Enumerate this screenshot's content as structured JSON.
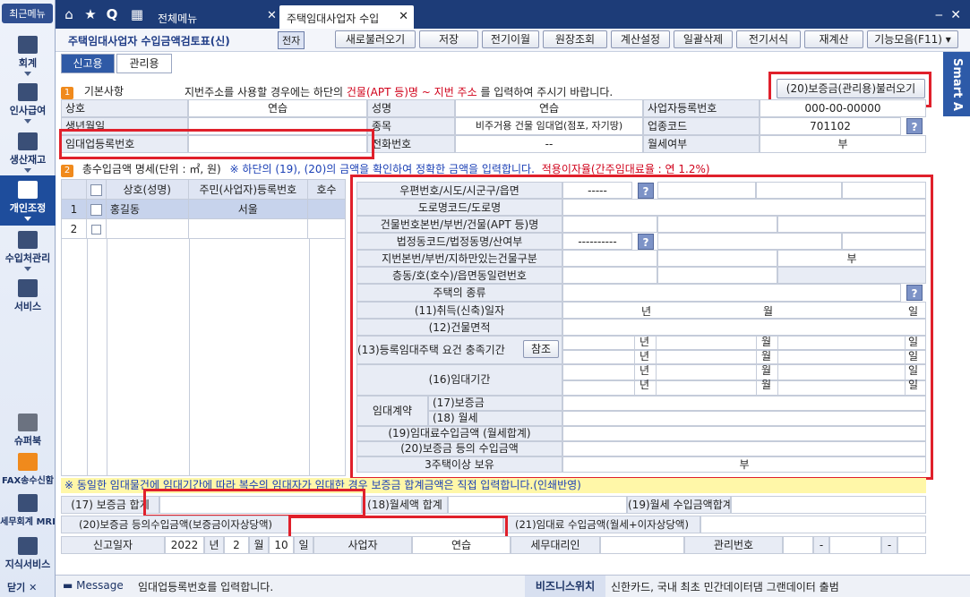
{
  "sidebar": {
    "top_label": "최근메뉴",
    "items": [
      {
        "label": "회계"
      },
      {
        "label": "인사급여"
      },
      {
        "label": "생산재고"
      },
      {
        "label": "개인조정"
      },
      {
        "label": "수입처관리"
      },
      {
        "label": "서비스"
      },
      {
        "label": "슈퍼북"
      },
      {
        "label": "FAX송수신함"
      },
      {
        "label": "세무회계 MRI"
      },
      {
        "label": "지식서비스"
      }
    ],
    "close_label": "닫기"
  },
  "tabs": [
    {
      "label": "전체메뉴"
    },
    {
      "label": "주택임대사업자 수입"
    }
  ],
  "toolbar": {
    "title": "주택임대사업자 수입금액검토표(신)",
    "badge": "전자",
    "buttons": [
      "새로불러오기",
      "저장",
      "전기이월",
      "원장조회",
      "계산설정",
      "일괄삭제",
      "전기서식",
      "재계산",
      "기능모음(F11)"
    ]
  },
  "subtabs": [
    "신고용",
    "관리용"
  ],
  "smart_label": "Smart A",
  "section1": {
    "num": "1",
    "title": "기본사항",
    "notice_a": "지번주소를 사용할 경우에는 하단의 ",
    "notice_red": "건물(APT 등)명 ~ 지번 주소",
    "notice_b": " 를 입력하여 주시기 바랍니다.",
    "load_button": "(20)보증금(관리용)불러오기",
    "labels": {
      "company": "상호",
      "name": "성명",
      "biz_no": "사업자등록번호",
      "birth": "생년월일",
      "type": "종목",
      "biz_code": "업종코드",
      "rental_reg": "임대업등록번호",
      "phone": "전화번호",
      "monthly": "월세여부"
    },
    "values": {
      "company": "연습",
      "name": "연습",
      "biz_no": "000-00-00000",
      "type": "비주거용 건물 임대업(점포, 자기땅)",
      "biz_code": "701102",
      "phone": "--",
      "monthly": "부"
    }
  },
  "section2": {
    "num": "2",
    "title": "총수입금액 명세(단위 : ㎡, 원)",
    "notice_blue": "※ 하단의 (19), (20)의 금액을 확인하여 정확한 금액을 입력합니다.",
    "notice_red": "적용이자율(간주임대료율 : 연 1.2%)",
    "table_headers": [
      "상호(성명)",
      "주민(사업자)등록번호",
      "호수"
    ],
    "rows": [
      {
        "no": "1",
        "name": "홍길동",
        "id": "서울",
        "unit": ""
      },
      {
        "no": "2",
        "name": "",
        "id": "",
        "unit": ""
      }
    ]
  },
  "detail": {
    "postal": "우편번호/시도/시군구/읍면",
    "postal_val": "-----",
    "road": "도로명코드/도로명",
    "building": "건물번호본번/부번/건물(APT 등)명",
    "legal": "법정동코드/법정동명/산여부",
    "legal_val": "----------",
    "lot": "지번본번/부번/지하만있는건물구분",
    "lot_val": "부",
    "floor": "층동/호(호수)/읍면동일련번호",
    "house_type": "주택의 종류",
    "acq": "(11)취득(신축)일자",
    "area": "(12)건물면적",
    "period": "(13)등록임대주택 요건 충족기간",
    "ref_btn": "참조",
    "rent_period": "(16)임대기간",
    "contract": "임대계약",
    "deposit": "(17)보증금",
    "rent": "(18) 월세",
    "rent_total": "(19)임대료수입금액 (월세합계)",
    "deposit_income": "(20)보증금 등의 수입금액",
    "three": "3주택이상 보유",
    "three_val": "부",
    "year": "년",
    "month": "월",
    "day": "일"
  },
  "bottom": {
    "notice": "※ 동일한 임대물건에 임대기간에 따라 복수의 임대자가 임대한 경우 보증금 합계금액은 직접 입력합니다.(인쇄반영)",
    "deposit_sum": "(17) 보증금 합계",
    "rent_sum": "(18)월세액 합계",
    "rent_income_sum": "(19)월세 수입금액합계",
    "deposit_income_sum": "(20)보증금 등의수입금액(보증금이자상당액)",
    "rental_income_sum": "(21)임대료 수입금액(월세+이자상당액)",
    "report_date": "신고일자",
    "year_val": "2022",
    "year": "년",
    "month_val": "2",
    "month": "월",
    "day_val": "10",
    "day": "일",
    "businessman": "사업자",
    "businessman_val": "연습",
    "agent": "세무대리인",
    "manage_no": "관리번호",
    "dash": "-"
  },
  "message": {
    "label": "Message",
    "text": "임대업등록번호를 입력합니다.",
    "biz_label": "비즈니스위치",
    "biz_text": "신한카드, 국내 최초 민간데이터댐 그랜데이터 출범"
  }
}
